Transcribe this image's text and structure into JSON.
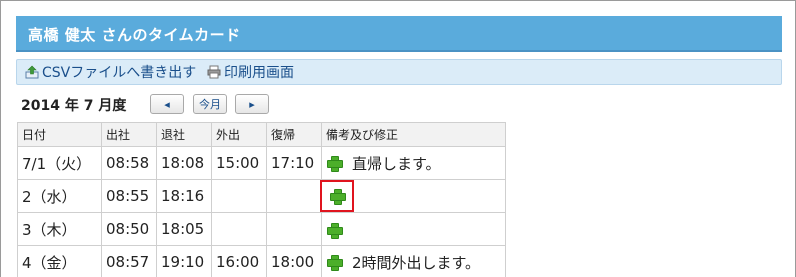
{
  "header": {
    "title": "高橋 健太 さんのタイムカード"
  },
  "toolbar": {
    "csv_label": "CSVファイルへ書き出す",
    "print_label": "印刷用画面"
  },
  "period": {
    "label": "2014 年 7 月度",
    "prev_label": "◂",
    "current_label": "今月",
    "next_label": "▸"
  },
  "table": {
    "headers": [
      "日付",
      "出社",
      "退社",
      "外出",
      "復帰",
      "備考及び修正"
    ],
    "rows": [
      {
        "date": "7/1（火）",
        "in": "08:58",
        "out": "18:08",
        "go_out": "15:00",
        "return": "17:10",
        "note": "直帰します。"
      },
      {
        "date": "2（水）",
        "in": "08:55",
        "out": "18:16",
        "go_out": "",
        "return": "",
        "note": ""
      },
      {
        "date": "3（木）",
        "in": "08:50",
        "out": "18:05",
        "go_out": "",
        "return": "",
        "note": ""
      },
      {
        "date": "4（金）",
        "in": "08:57",
        "out": "19:10",
        "go_out": "16:00",
        "return": "18:00",
        "note": "2時間外出します。"
      }
    ]
  },
  "colors": {
    "title_bg": "#5aabdc",
    "toolbar_bg": "#dbecf8",
    "link": "#1a4f8b",
    "plus_green": "#4caf2a",
    "highlight": "#e0141e"
  },
  "icons": {
    "csv": "export-icon",
    "print": "printer-icon",
    "add": "plus-icon"
  }
}
